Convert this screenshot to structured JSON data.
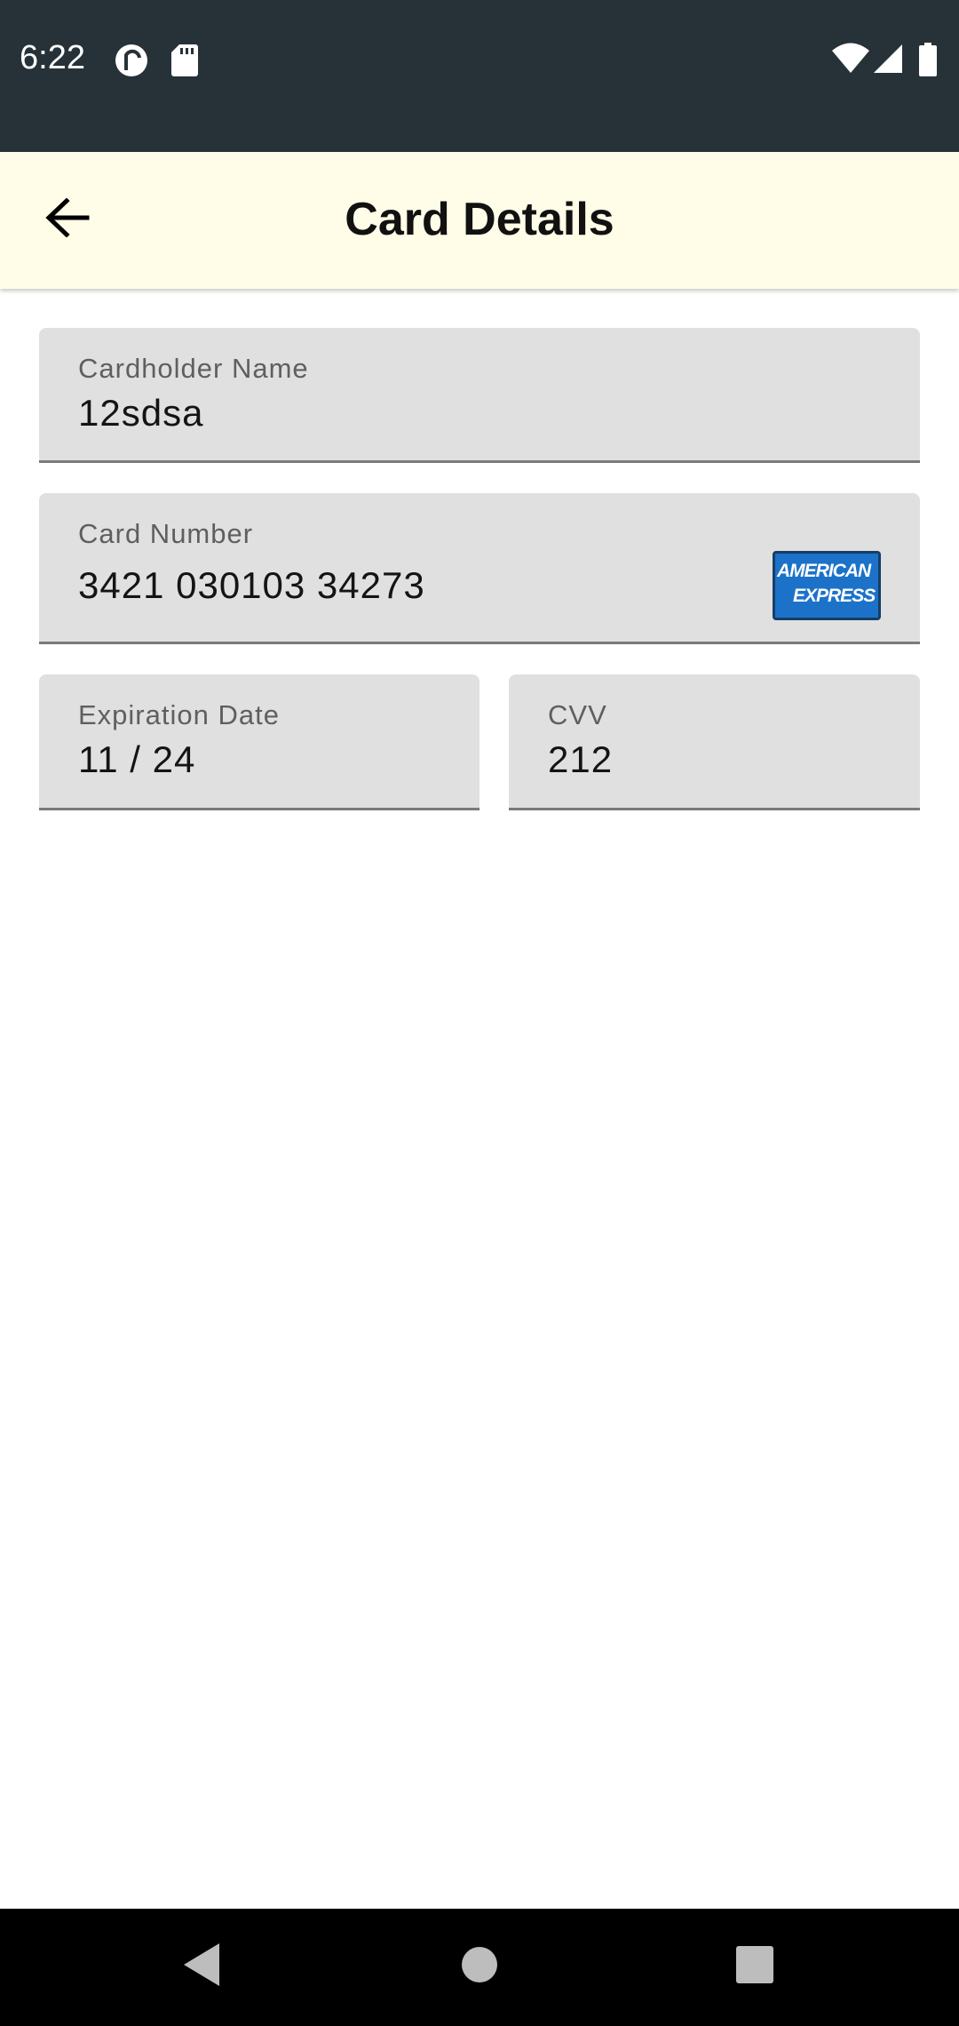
{
  "status_bar": {
    "time": "6:22",
    "icons": [
      "pocket-casts-icon",
      "sd-card-icon",
      "wifi-icon",
      "signal-icon",
      "battery-icon"
    ]
  },
  "app_bar": {
    "title": "Card Details",
    "back_icon": "arrow-back-icon"
  },
  "form": {
    "cardholder_name": {
      "label": "Cardholder Name",
      "value": "12sdsa"
    },
    "card_number": {
      "label": "Card Number",
      "value": "3421 030103 34273",
      "brand_line1": "AMERICAN",
      "brand_line2": "EXPRESS"
    },
    "expiration_date": {
      "label": "Expiration Date",
      "value": "11 / 24"
    },
    "cvv": {
      "label": "CVV",
      "value": "212"
    }
  },
  "nav_bar": {
    "icons": [
      "back-triangle-icon",
      "home-circle-icon",
      "recents-square-icon"
    ]
  },
  "colors": {
    "status_bar": "#263238",
    "app_bar": "#fffde7",
    "field_bg": "#e0e0e0",
    "amex_blue": "#1c72c9"
  }
}
